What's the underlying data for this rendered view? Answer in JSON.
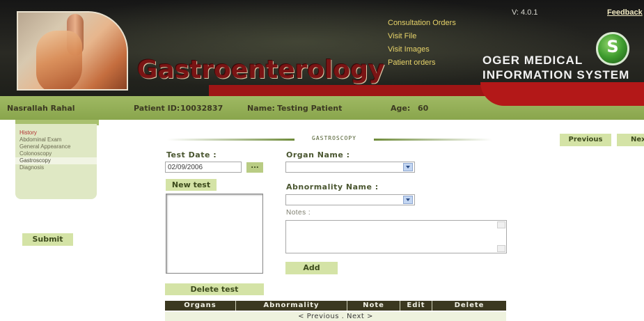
{
  "header": {
    "title": "Gastroenterology",
    "version": "V: 4.0.1",
    "feedback": "Feedback",
    "nav": [
      "Consultation Orders",
      "Visit File",
      "Visit Images",
      "Patient orders"
    ],
    "brand_line1": "OGER MEDICAL",
    "brand_line2": "INFORMATION SYSTEM",
    "logo_letter": "S"
  },
  "patient": {
    "doctor": "Nasrallah Rahal",
    "id_label": "Patient ID:",
    "id_value": "10032837",
    "name_label": "Name:",
    "name_value": "Testing Patient",
    "age_label": "Age:",
    "age_value": "60"
  },
  "sidebar": {
    "items": [
      "History",
      "Abdominal Exam",
      "General Appearance",
      "Colonoscopy",
      "Gastroscopy",
      "Diagnosis"
    ],
    "active_index": 4
  },
  "buttons": {
    "submit": "Submit",
    "previous": "Previous",
    "next": "Next",
    "new_test": "New test",
    "delete_test": "Delete test",
    "add": "Add",
    "date_picker": "..."
  },
  "section": {
    "title": "GASTROSCOPY"
  },
  "form": {
    "test_date_label": "Test Date :",
    "test_date_value": "02/09/2006",
    "organ_label": "Organ Name :",
    "organ_value": "",
    "abnormality_label": "Abnormality Name :",
    "abnormality_value": "",
    "notes_label": "Notes :",
    "notes_value": ""
  },
  "table": {
    "headers": [
      "Organs",
      "Abnormality",
      "Note",
      "Edit",
      "Delete"
    ],
    "pager_prev": "< Previous",
    "pager_sep": ".",
    "pager_next": "Next >"
  },
  "colors": {
    "header_bg": "#1e1f1a",
    "title_red": "#7a1414",
    "nav_yellow": "#e8d46a",
    "patient_bar": "#89a54c",
    "button_green": "#d4e3a6",
    "table_header": "#3b3820"
  }
}
